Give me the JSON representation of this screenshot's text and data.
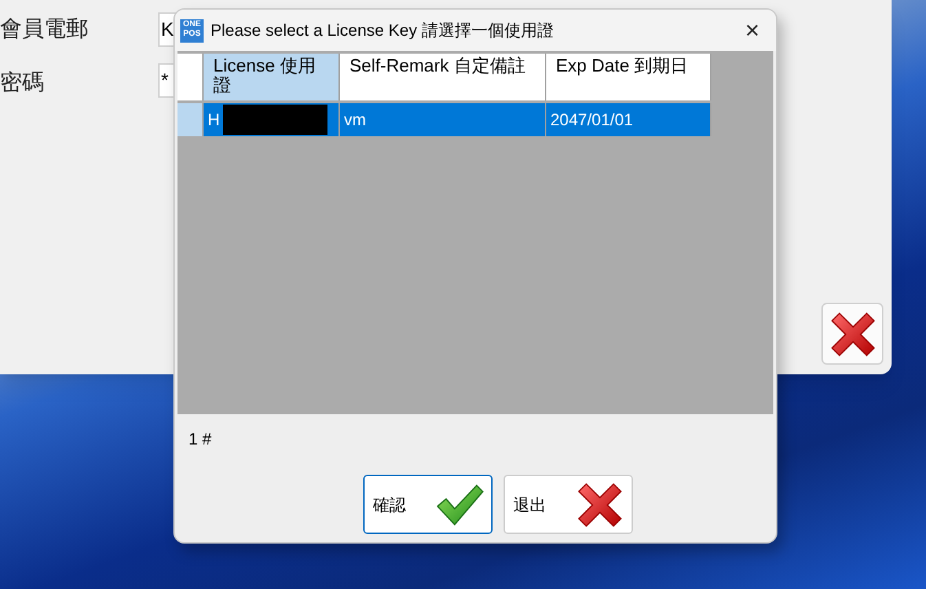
{
  "background_window": {
    "fields": [
      {
        "label": "會員電郵",
        "value": "K"
      },
      {
        "label": "密碼",
        "value": "*"
      }
    ],
    "close_button": {
      "kind": "cancel"
    }
  },
  "dialog": {
    "logo": [
      "ONE",
      "POS"
    ],
    "title": "Please select a License Key 請選擇一個使用證",
    "close": "×",
    "columns": [
      {
        "label": "License 使用證",
        "selected": true
      },
      {
        "label": "Self-Remark 自定備註",
        "selected": false
      },
      {
        "label": "Exp Date 到期日",
        "selected": false
      }
    ],
    "rows": [
      {
        "selected": true,
        "redacted": true,
        "cells": [
          "H",
          "vm",
          "2047/01/01"
        ]
      }
    ],
    "record_count": "1 #",
    "buttons": [
      {
        "label": "確認",
        "kind": "confirm",
        "focused": true
      },
      {
        "label": "退出",
        "kind": "cancel",
        "focused": false
      }
    ]
  }
}
